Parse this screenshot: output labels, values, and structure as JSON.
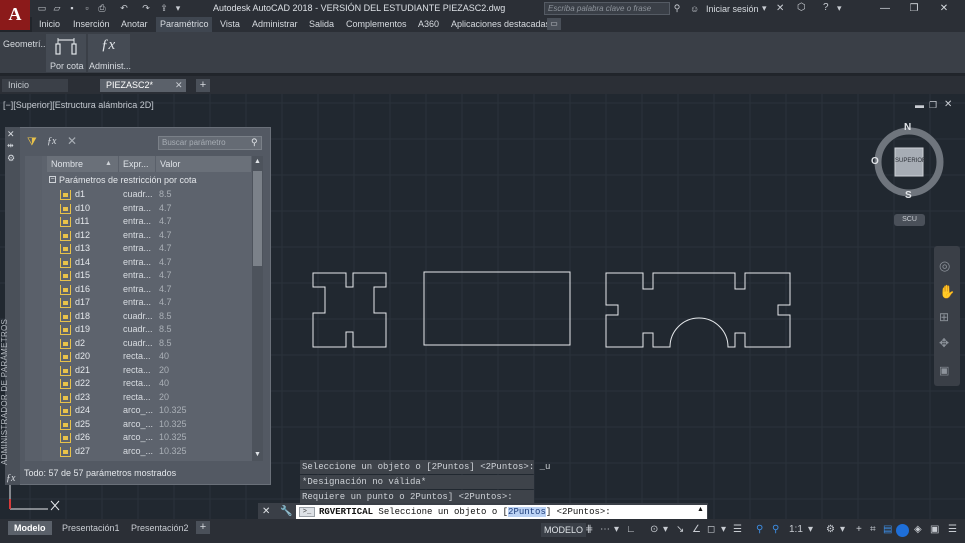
{
  "app": {
    "logo_letter": "A",
    "title": "Autodesk AutoCAD 2018 - VERSIÓN DEL ESTUDIANTE    PIEZASC2.dwg",
    "search_placeholder": "Escriba palabra clave o frase",
    "sign_in": "Iniciar sesión"
  },
  "menu": {
    "items": [
      "Inicio",
      "Inserción",
      "Anotar",
      "Paramétrico",
      "Vista",
      "Administrar",
      "Salida",
      "Complementos",
      "A360",
      "Aplicaciones destacadas"
    ],
    "active": "Paramétrico"
  },
  "ribbon": {
    "group_label": "Geometrí...",
    "buttons": [
      {
        "label": "Por cota",
        "icon": "dimensional-constraint-icon"
      },
      {
        "label": "Administ...",
        "icon": "fx-icon"
      }
    ]
  },
  "doc_tabs": [
    {
      "label": "Inicio"
    },
    {
      "label": "PIEZASC2*"
    }
  ],
  "viewport_label": "[−][Superior][Estructura alámbrica 2D]",
  "param_manager": {
    "side_title": "ADMINISTRADOR DE PARÁMETROS",
    "search_placeholder": "Buscar parámetro",
    "columns": [
      "Nombre",
      "Expr...",
      "Valor"
    ],
    "group": "Parámetros de restricción por cota",
    "rows": [
      {
        "name": "d1",
        "expr": "cuadr...",
        "value": "8.5"
      },
      {
        "name": "d10",
        "expr": "entra...",
        "value": "4.7"
      },
      {
        "name": "d11",
        "expr": "entra...",
        "value": "4.7"
      },
      {
        "name": "d12",
        "expr": "entra...",
        "value": "4.7"
      },
      {
        "name": "d13",
        "expr": "entra...",
        "value": "4.7"
      },
      {
        "name": "d14",
        "expr": "entra...",
        "value": "4.7"
      },
      {
        "name": "d15",
        "expr": "entra...",
        "value": "4.7"
      },
      {
        "name": "d16",
        "expr": "entra...",
        "value": "4.7"
      },
      {
        "name": "d17",
        "expr": "entra...",
        "value": "4.7"
      },
      {
        "name": "d18",
        "expr": "cuadr...",
        "value": "8.5"
      },
      {
        "name": "d19",
        "expr": "cuadr...",
        "value": "8.5"
      },
      {
        "name": "d2",
        "expr": "cuadr...",
        "value": "8.5"
      },
      {
        "name": "d20",
        "expr": "recta...",
        "value": "40"
      },
      {
        "name": "d21",
        "expr": "recta...",
        "value": "20"
      },
      {
        "name": "d22",
        "expr": "recta...",
        "value": "40"
      },
      {
        "name": "d23",
        "expr": "recta...",
        "value": "20"
      },
      {
        "name": "d24",
        "expr": "arco_...",
        "value": "10.325"
      },
      {
        "name": "d25",
        "expr": "arco_...",
        "value": "10.325"
      },
      {
        "name": "d26",
        "expr": "arco_...",
        "value": "10.325"
      },
      {
        "name": "d27",
        "expr": "arco_...",
        "value": "10.325"
      }
    ],
    "footer": "Todo: 57 de 57 parámetros mostrados"
  },
  "viewcube": {
    "north": "N",
    "south": "S",
    "west": "O",
    "face": "SUPERIOR",
    "ucs": "SCU"
  },
  "command": {
    "history": [
      "Seleccione un objeto o [2Puntos] <2Puntos>: _u",
      "*Designación no válida*",
      "Requiere un punto o 2Puntos] <2Puntos>:"
    ],
    "prompt_cmd": "RGVERTICAL",
    "prompt_text": "Seleccione un objeto o [",
    "prompt_option": "2Puntos",
    "prompt_tail": "] <2Puntos>:"
  },
  "layout_tabs": [
    "Modelo",
    "Presentación1",
    "Presentación2"
  ],
  "status": {
    "model_label": "MODELO",
    "scale": "1:1"
  },
  "colors": {
    "accent": "#1e6fd9",
    "logo": "#8b1a1a",
    "constraint_icon": "#e8c24a"
  }
}
